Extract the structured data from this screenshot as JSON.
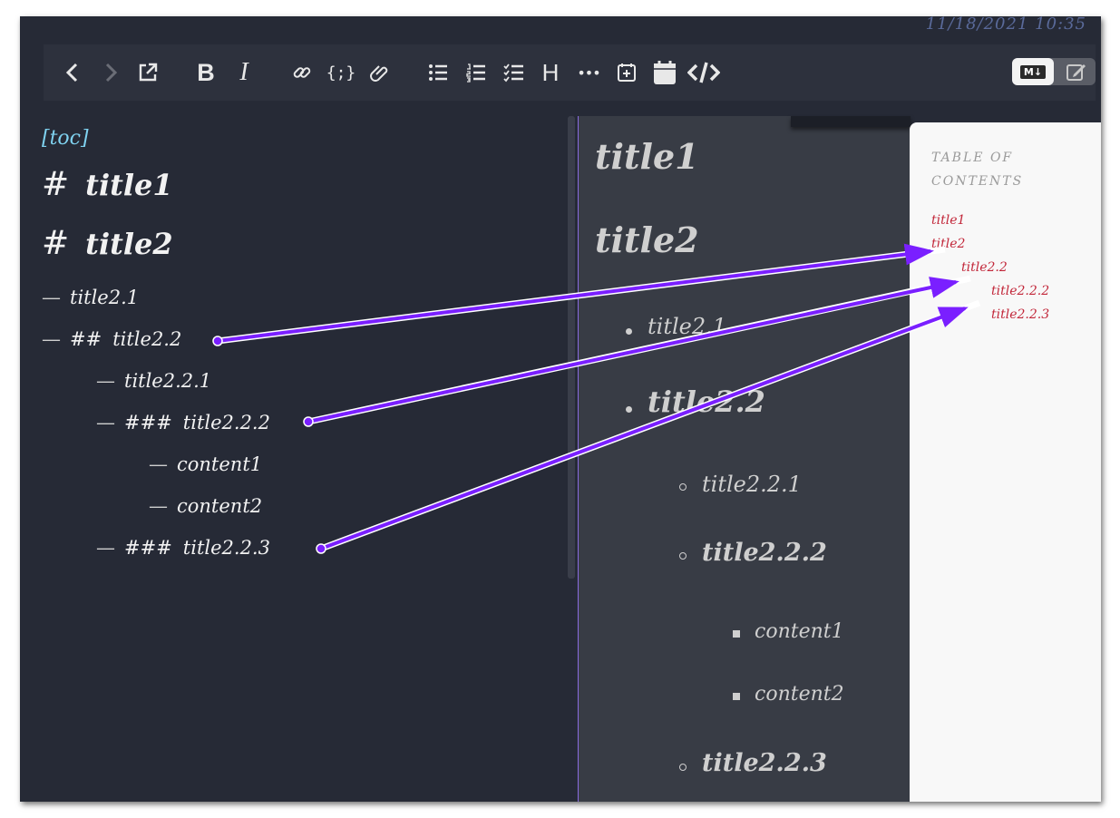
{
  "header": {
    "timestamp": "11/18/2021 10:35"
  },
  "toolbar": {
    "icons": [
      "back-icon",
      "forward-icon",
      "open-external-icon",
      "bold-icon",
      "italic-icon",
      "link-icon",
      "code-icon",
      "attachment-icon",
      "bullet-list-icon",
      "numbered-list-icon",
      "checklist-icon",
      "heading-icon",
      "more-icon",
      "add-block-icon",
      "calendar-icon",
      "code-view-icon",
      "markdown-icon",
      "edit-icon"
    ],
    "bold_label": "B",
    "italic_label": "I",
    "code_label": "{;}",
    "heading_label": "H",
    "more_label": "•••",
    "markdown_label": "M↓"
  },
  "editor": {
    "toc_tag": "[toc]",
    "hash1": "#",
    "hash2": "##",
    "hash3": "###",
    "dash": "—",
    "lines": {
      "title1": "title1",
      "title2": "title2",
      "title2_1": "title2.1",
      "title2_2": "title2.2",
      "title2_2_1": "title2.2.1",
      "title2_2_2": "title2.2.2",
      "content1": "content1",
      "content2": "content2",
      "title2_2_3": "title2.2.3"
    }
  },
  "preview": {
    "title1": "title1",
    "title2": "title2",
    "title2_1": "title2.1",
    "title2_2": "title2.2",
    "title2_2_1": "title2.2.1",
    "title2_2_2": "title2.2.2",
    "content1": "content1",
    "content2": "content2",
    "title2_2_3": "title2.2.3"
  },
  "toc_panel": {
    "heading": "TABLE OF CONTENTS",
    "items": [
      "title1",
      "title2",
      "title2.2",
      "title2.2.2",
      "title2.2.3"
    ]
  },
  "colors": {
    "arrow": "#7a1fff",
    "toc_link": "#c2273a",
    "toc_tag": "#7fd2f0"
  }
}
